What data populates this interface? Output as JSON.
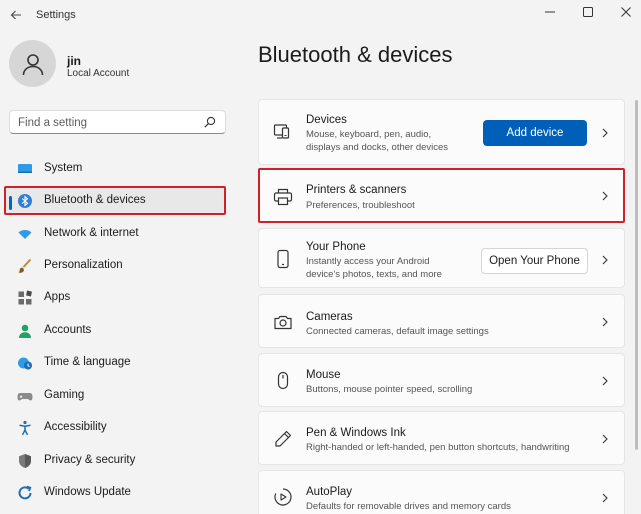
{
  "window": {
    "title": "Settings"
  },
  "account": {
    "name": "jin",
    "type": "Local Account"
  },
  "search": {
    "placeholder": "Find a setting"
  },
  "sidebar": {
    "items": [
      {
        "label": "System",
        "icon": "display-icon"
      },
      {
        "label": "Bluetooth & devices",
        "icon": "bluetooth-icon",
        "active": true
      },
      {
        "label": "Network & internet",
        "icon": "wifi-icon"
      },
      {
        "label": "Personalization",
        "icon": "brush-icon"
      },
      {
        "label": "Apps",
        "icon": "apps-icon"
      },
      {
        "label": "Accounts",
        "icon": "person-icon"
      },
      {
        "label": "Time & language",
        "icon": "clock-globe-icon"
      },
      {
        "label": "Gaming",
        "icon": "gamepad-icon"
      },
      {
        "label": "Accessibility",
        "icon": "accessibility-icon"
      },
      {
        "label": "Privacy & security",
        "icon": "shield-icon"
      },
      {
        "label": "Windows Update",
        "icon": "update-icon"
      }
    ]
  },
  "main": {
    "title": "Bluetooth & devices",
    "cards": [
      {
        "title": "Devices",
        "desc_line1": "Mouse, keyboard, pen, audio,",
        "desc_line2": "displays and docks, other devices",
        "button": "Add device",
        "icon": "devices-icon"
      },
      {
        "title": "Printers & scanners",
        "desc_line1": "Preferences, troubleshoot",
        "icon": "printer-icon",
        "highlighted": true
      },
      {
        "title": "Your Phone",
        "desc_line1": "Instantly access your Android",
        "desc_line2": "device's photos, texts, and more",
        "button": "Open Your Phone",
        "icon": "phone-icon"
      },
      {
        "title": "Cameras",
        "desc_line1": "Connected cameras, default image settings",
        "icon": "camera-icon"
      },
      {
        "title": "Mouse",
        "desc_line1": "Buttons, mouse pointer speed, scrolling",
        "icon": "mouse-icon"
      },
      {
        "title": "Pen & Windows Ink",
        "desc_line1": "Right-handed or left-handed, pen button shortcuts, handwriting",
        "icon": "pen-icon"
      },
      {
        "title": "AutoPlay",
        "desc_line1": "Defaults for removable drives and memory cards",
        "icon": "autoplay-icon"
      }
    ]
  },
  "colors": {
    "accent": "#005fb8",
    "highlight_border": "#d0202a",
    "background": "#f3f3f3"
  }
}
